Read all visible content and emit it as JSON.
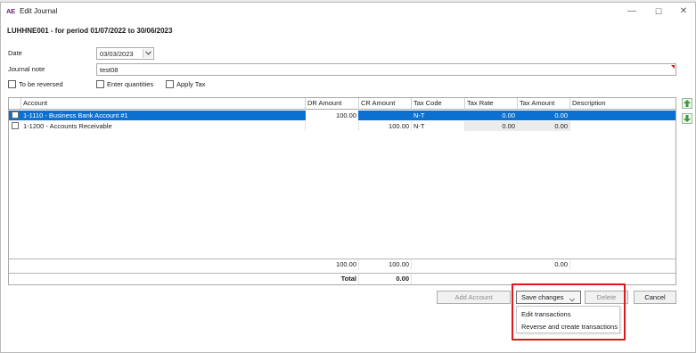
{
  "window": {
    "title": "Edit Journal",
    "app_icon": "AE"
  },
  "heading": "LUHHNE001 - for period 01/07/2022 to 30/06/2023",
  "date": {
    "label": "Date",
    "value": "03/03/2023"
  },
  "journal_note": {
    "label": "Journal note",
    "value": "test08"
  },
  "options": {
    "reversed": "To be reversed",
    "quantities": "Enter quantities",
    "apply_tax": "Apply Tax"
  },
  "grid": {
    "columns": [
      "Account",
      "DR Amount",
      "CR Amount",
      "Tax Code",
      "Tax Rate",
      "Tax Amount",
      "Description"
    ],
    "rows": [
      {
        "account": "1-1110 - Business Bank Account #1",
        "dr": "100.00",
        "cr": "",
        "tax_code": "N-T",
        "tax_rate": "0.00",
        "tax_amount": "0.00",
        "description": "",
        "selected": true
      },
      {
        "account": "1-1200 - Accounts Receivable",
        "dr": "",
        "cr": "100.00",
        "tax_code": "N-T",
        "tax_rate": "0.00",
        "tax_amount": "0.00",
        "description": "",
        "selected": false
      }
    ],
    "totals": {
      "dr": "100.00",
      "cr": "100.00",
      "tax_amount": "0.00"
    },
    "total_row": {
      "label": "Total",
      "value": "0.00"
    }
  },
  "buttons": {
    "add_account": "Add Account",
    "save_changes": "Save changes",
    "delete": "Delete",
    "cancel": "Cancel"
  },
  "menu": {
    "items": [
      "Edit transactions",
      "Reverse and create transactions"
    ]
  },
  "colors": {
    "selection": "#0a70d2",
    "highlight": "#e0161a",
    "app_icon": "#6a1f7f"
  }
}
